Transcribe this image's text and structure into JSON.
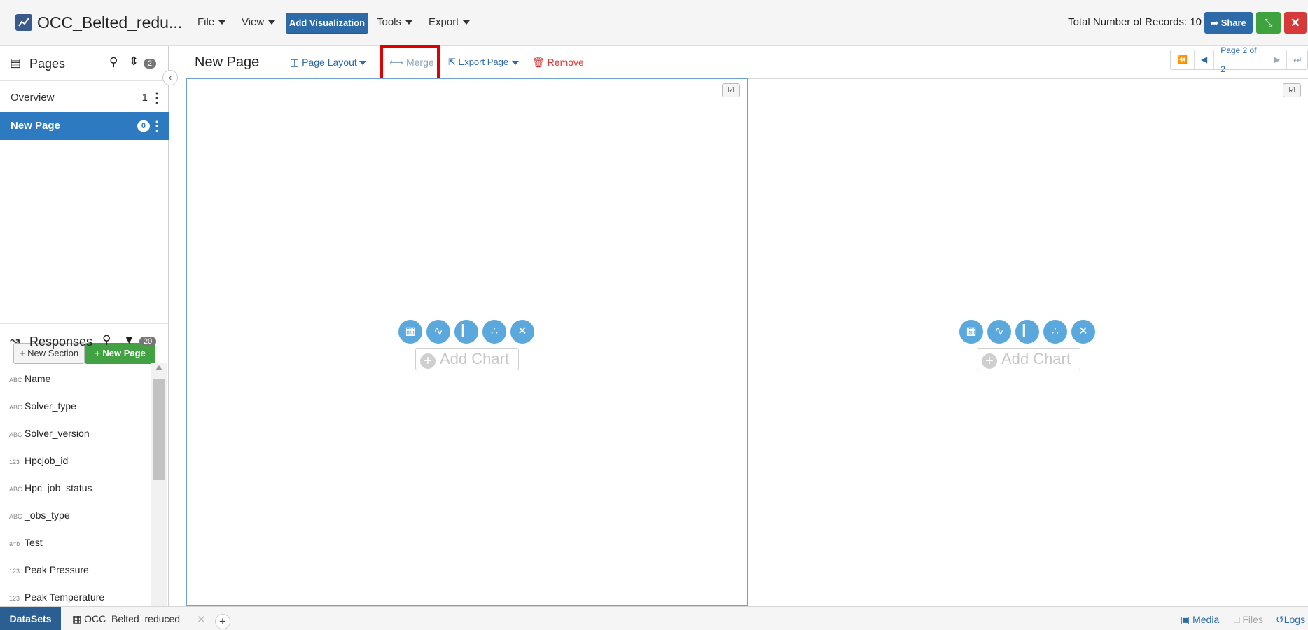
{
  "header": {
    "title": "OCC_Belted_redu...",
    "menus": [
      "File",
      "View",
      "Tools",
      "Export"
    ],
    "add_visualization": "Add Visualization",
    "records": "Total Number of Records: 10",
    "share": "Share"
  },
  "pages_panel": {
    "title": "Pages",
    "count": "2",
    "items": [
      {
        "label": "Overview",
        "count": "1"
      },
      {
        "label": "New Page",
        "count": "0"
      }
    ],
    "new_section": "New Section",
    "new_page": "New Page"
  },
  "responses_panel": {
    "title": "Responses",
    "count": "20",
    "items": [
      {
        "type": "ABC",
        "label": "Name"
      },
      {
        "type": "ABC",
        "label": "Solver_type"
      },
      {
        "type": "ABC",
        "label": "Solver_version"
      },
      {
        "type": "123",
        "label": "Hpcjob_id"
      },
      {
        "type": "ABC",
        "label": "Hpc_job_status"
      },
      {
        "type": "ABC",
        "label": "_obs_type"
      },
      {
        "type": "a=b",
        "label": "Test"
      },
      {
        "type": "123",
        "label": "Peak Pressure"
      },
      {
        "type": "123",
        "label": "Peak Temperature"
      }
    ]
  },
  "toolbar": {
    "page_name": "New Page",
    "page_layout": "Page Layout",
    "merge": "Merge",
    "export_page": "Export Page",
    "remove": "Remove",
    "pager_label": "Page 2 of 2"
  },
  "panels": {
    "add_chart": "Add Chart"
  },
  "footer": {
    "datasets": "DataSets",
    "dataset_name": "OCC_Belted_reduced",
    "media": "Media",
    "files": "Files",
    "logs": "Logs"
  },
  "colors": {
    "primary": "#2c6aa8",
    "success": "#42a142",
    "danger": "#d73a3a",
    "active_page": "#2d7ac0",
    "chart_icon": "#5aa8dc",
    "highlight": "#e00000"
  }
}
